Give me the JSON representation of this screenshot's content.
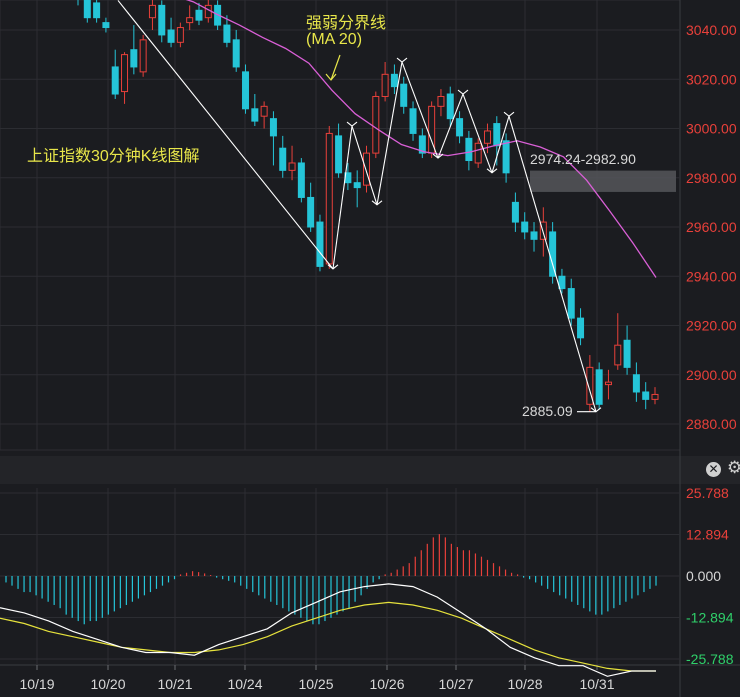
{
  "chart_data": [
    {
      "type": "candlestick",
      "title": "上证指数30分钟K线图解",
      "ma_label_line1": "强弱分界线",
      "ma_label_line2": "(MA 20)",
      "ylim": [
        2878,
        3053
      ],
      "yticks": [
        "3040.00",
        "3020.00",
        "3000.00",
        "2980.00",
        "2960.00",
        "2940.00",
        "2920.00",
        "2900.00",
        "2880.00"
      ],
      "ytick_values": [
        3040,
        3020,
        3000,
        2980,
        2960,
        2940,
        2920,
        2900,
        2880
      ],
      "xticks": [
        "10/19",
        "10/20",
        "10/21",
        "10/24",
        "10/25",
        "10/26",
        "10/27",
        "10/28",
        "10/31"
      ],
      "resistance_zone": {
        "low": 2974.24,
        "high": 2982.9,
        "label": "2974.24-2982.90"
      },
      "low_label": "2885.09",
      "grid": true,
      "candles": [
        [
          3061,
          3065,
          3053,
          3050
        ],
        [
          3055,
          3058,
          3045,
          3043
        ],
        [
          3051,
          3054,
          3045,
          3043
        ],
        [
          3043,
          3045,
          3041,
          3039
        ],
        [
          3025,
          3032,
          3014,
          3012
        ],
        [
          3015,
          3031,
          3030,
          3010
        ],
        [
          3032,
          3042,
          3025,
          3022
        ],
        [
          3023,
          3038,
          3036,
          3021
        ],
        [
          3045,
          3055,
          3050,
          3040
        ],
        [
          3050,
          3052,
          3038,
          3035
        ],
        [
          3040,
          3045,
          3035,
          3033
        ],
        [
          3035,
          3043,
          3041,
          3033
        ],
        [
          3043,
          3050,
          3045,
          3040
        ],
        [
          3048,
          3051,
          3044,
          3042
        ],
        [
          3045,
          3053,
          3050,
          3043
        ],
        [
          3050,
          3052,
          3042,
          3040
        ],
        [
          3042,
          3046,
          3035,
          3033
        ],
        [
          3036,
          3040,
          3025,
          3023
        ],
        [
          3023,
          3026,
          3008,
          3006
        ],
        [
          3008,
          3014,
          3003,
          3001
        ],
        [
          3005,
          3011,
          3009,
          3000
        ],
        [
          3004,
          3007,
          2997,
          2985
        ],
        [
          2992,
          2997,
          2983,
          2980
        ],
        [
          2983,
          2993,
          2986,
          2979
        ],
        [
          2986,
          2988,
          2972,
          2970
        ],
        [
          2972,
          2978,
          2960,
          2958
        ],
        [
          2962,
          2965,
          2944,
          2942
        ],
        [
          2945,
          3001,
          2998,
          2943
        ],
        [
          2997,
          3002,
          2982,
          2980
        ],
        [
          2982,
          2986,
          2978,
          2975
        ],
        [
          2978,
          2983,
          2976,
          2968
        ],
        [
          2977,
          2993,
          2990,
          2974
        ],
        [
          2990,
          3015,
          3013,
          2988
        ],
        [
          3013,
          3027,
          3022,
          3011
        ],
        [
          3022,
          3026,
          3017,
          3014
        ],
        [
          3018,
          3021,
          3009,
          3006
        ],
        [
          3008,
          3011,
          2998,
          2995
        ],
        [
          2997,
          3000,
          2990,
          2988
        ],
        [
          2990,
          3011,
          3009,
          2988
        ],
        [
          3009,
          3016,
          3013,
          3005
        ],
        [
          3014,
          3017,
          3004,
          3001
        ],
        [
          3004,
          3007,
          2997,
          2994
        ],
        [
          2996,
          2999,
          2987,
          2983
        ],
        [
          2986,
          2996,
          2994,
          2984
        ],
        [
          2994,
          3002,
          2999,
          2990
        ],
        [
          3002,
          3005,
          2993,
          2985
        ],
        [
          2995,
          2998,
          2982,
          2978
        ],
        [
          2970,
          2974,
          2962,
          2958
        ],
        [
          2962,
          2966,
          2958,
          2955
        ],
        [
          2958,
          2962,
          2955,
          2950
        ],
        [
          2955,
          2968,
          2962,
          2948
        ],
        [
          2958,
          2962,
          2940,
          2937
        ],
        [
          2940,
          2943,
          2935,
          2933
        ],
        [
          2935,
          2939,
          2923,
          2920
        ],
        [
          2923,
          2927,
          2915,
          2912
        ],
        [
          2888,
          2908,
          2903,
          2885
        ],
        [
          2902,
          2905,
          2888,
          2886
        ],
        [
          2896,
          2902,
          2897,
          2890
        ],
        [
          2904,
          2925,
          2912,
          2902
        ],
        [
          2914,
          2920,
          2903,
          2900
        ],
        [
          2900,
          2905,
          2893,
          2889
        ],
        [
          2893,
          2897,
          2890,
          2886
        ],
        [
          2890,
          2895,
          2892,
          2888
        ]
      ],
      "ma20": [
        [
          3055,
          3054
        ],
        [
          3052,
          3051
        ],
        [
          3048,
          3045
        ],
        [
          3043,
          3041
        ],
        [
          3038,
          3036
        ],
        [
          3034,
          3031
        ],
        [
          3029,
          3024
        ],
        [
          3019,
          3012
        ],
        [
          3008,
          3004
        ],
        [
          3001,
          2998
        ],
        [
          2995,
          2992
        ],
        [
          2991,
          2990
        ],
        [
          2989,
          2989
        ],
        [
          2990,
          2991
        ],
        [
          2992,
          2994
        ],
        [
          2995,
          2995
        ],
        [
          2993,
          2992
        ],
        [
          2991,
          2986
        ],
        [
          2982,
          2976
        ],
        [
          2970,
          2963
        ],
        [
          2957,
          2950
        ],
        [
          2943,
          2936
        ]
      ]
    },
    {
      "type": "macd",
      "ylim": [
        -29,
        29
      ],
      "yticks": [
        "25.788",
        "12.894",
        "0.000",
        "-12.894",
        "-25.788"
      ],
      "ytick_values": [
        25.788,
        12.894,
        0,
        -12.894,
        -25.788
      ],
      "histogram": [
        -2,
        -3,
        -4,
        -5,
        -5,
        -6,
        -7,
        -8,
        -9,
        -10,
        -12,
        -13,
        -14,
        -15,
        -14,
        -14,
        -13,
        -12,
        -11,
        -10,
        -9,
        -8,
        -7,
        -6,
        -5,
        -4,
        -3,
        -2,
        -1,
        0.5,
        1,
        1.5,
        1.2,
        0.8,
        0.3,
        -0.5,
        -1,
        -1.5,
        -2,
        -3,
        -4,
        -5,
        -6,
        -7,
        -8,
        -9,
        -10,
        -11,
        -12,
        -13,
        -14,
        -15,
        -15,
        -14,
        -13,
        -12,
        -11,
        -10,
        -8,
        -6,
        -4,
        -2,
        -1,
        0.5,
        1,
        2,
        3,
        4,
        6,
        8,
        10,
        12,
        13,
        12,
        10,
        9,
        8,
        8,
        7,
        6,
        5,
        4,
        3,
        2,
        1,
        0.5,
        -0.5,
        -1,
        -2,
        -3,
        -4,
        -5,
        -6,
        -7,
        -8,
        -9,
        -10,
        -11,
        -12,
        -12,
        -11,
        -10,
        -9,
        -8,
        -7,
        -6,
        -5,
        -4,
        -3
      ],
      "dif": [
        [
          0,
          -12
        ],
        [
          1,
          -14
        ],
        [
          2,
          -17
        ],
        [
          3,
          -21
        ],
        [
          4,
          -24
        ],
        [
          5,
          -27
        ],
        [
          6,
          -29
        ],
        [
          7,
          -29
        ],
        [
          8,
          -30
        ],
        [
          9,
          -26
        ],
        [
          10,
          -23
        ],
        [
          11,
          -20
        ],
        [
          12,
          -14
        ],
        [
          13,
          -10
        ],
        [
          14,
          -6
        ],
        [
          15,
          -4
        ],
        [
          16,
          -3
        ],
        [
          17,
          -4
        ],
        [
          18,
          -8
        ],
        [
          19,
          -14
        ],
        [
          20,
          -20
        ],
        [
          21,
          -27
        ],
        [
          22,
          -31
        ],
        [
          23,
          -34
        ],
        [
          24,
          -34
        ],
        [
          25,
          -38
        ],
        [
          26,
          -36
        ],
        [
          27,
          -36
        ]
      ],
      "dea": [
        [
          0,
          -16
        ],
        [
          1,
          -18
        ],
        [
          2,
          -21
        ],
        [
          3,
          -23
        ],
        [
          4,
          -25
        ],
        [
          5,
          -27
        ],
        [
          6,
          -28
        ],
        [
          7,
          -29
        ],
        [
          8,
          -29
        ],
        [
          9,
          -28
        ],
        [
          10,
          -26
        ],
        [
          11,
          -23
        ],
        [
          12,
          -19
        ],
        [
          13,
          -16
        ],
        [
          14,
          -13
        ],
        [
          15,
          -11
        ],
        [
          16,
          -10
        ],
        [
          17,
          -11
        ],
        [
          18,
          -13
        ],
        [
          19,
          -16
        ],
        [
          20,
          -20
        ],
        [
          21,
          -24
        ],
        [
          22,
          -28
        ],
        [
          23,
          -31
        ],
        [
          24,
          -33
        ],
        [
          25,
          -35
        ],
        [
          26,
          -36
        ],
        [
          27,
          -36
        ]
      ]
    }
  ],
  "toolbar": {
    "close_icon": "close-icon",
    "settings_icon": "gear-icon"
  }
}
